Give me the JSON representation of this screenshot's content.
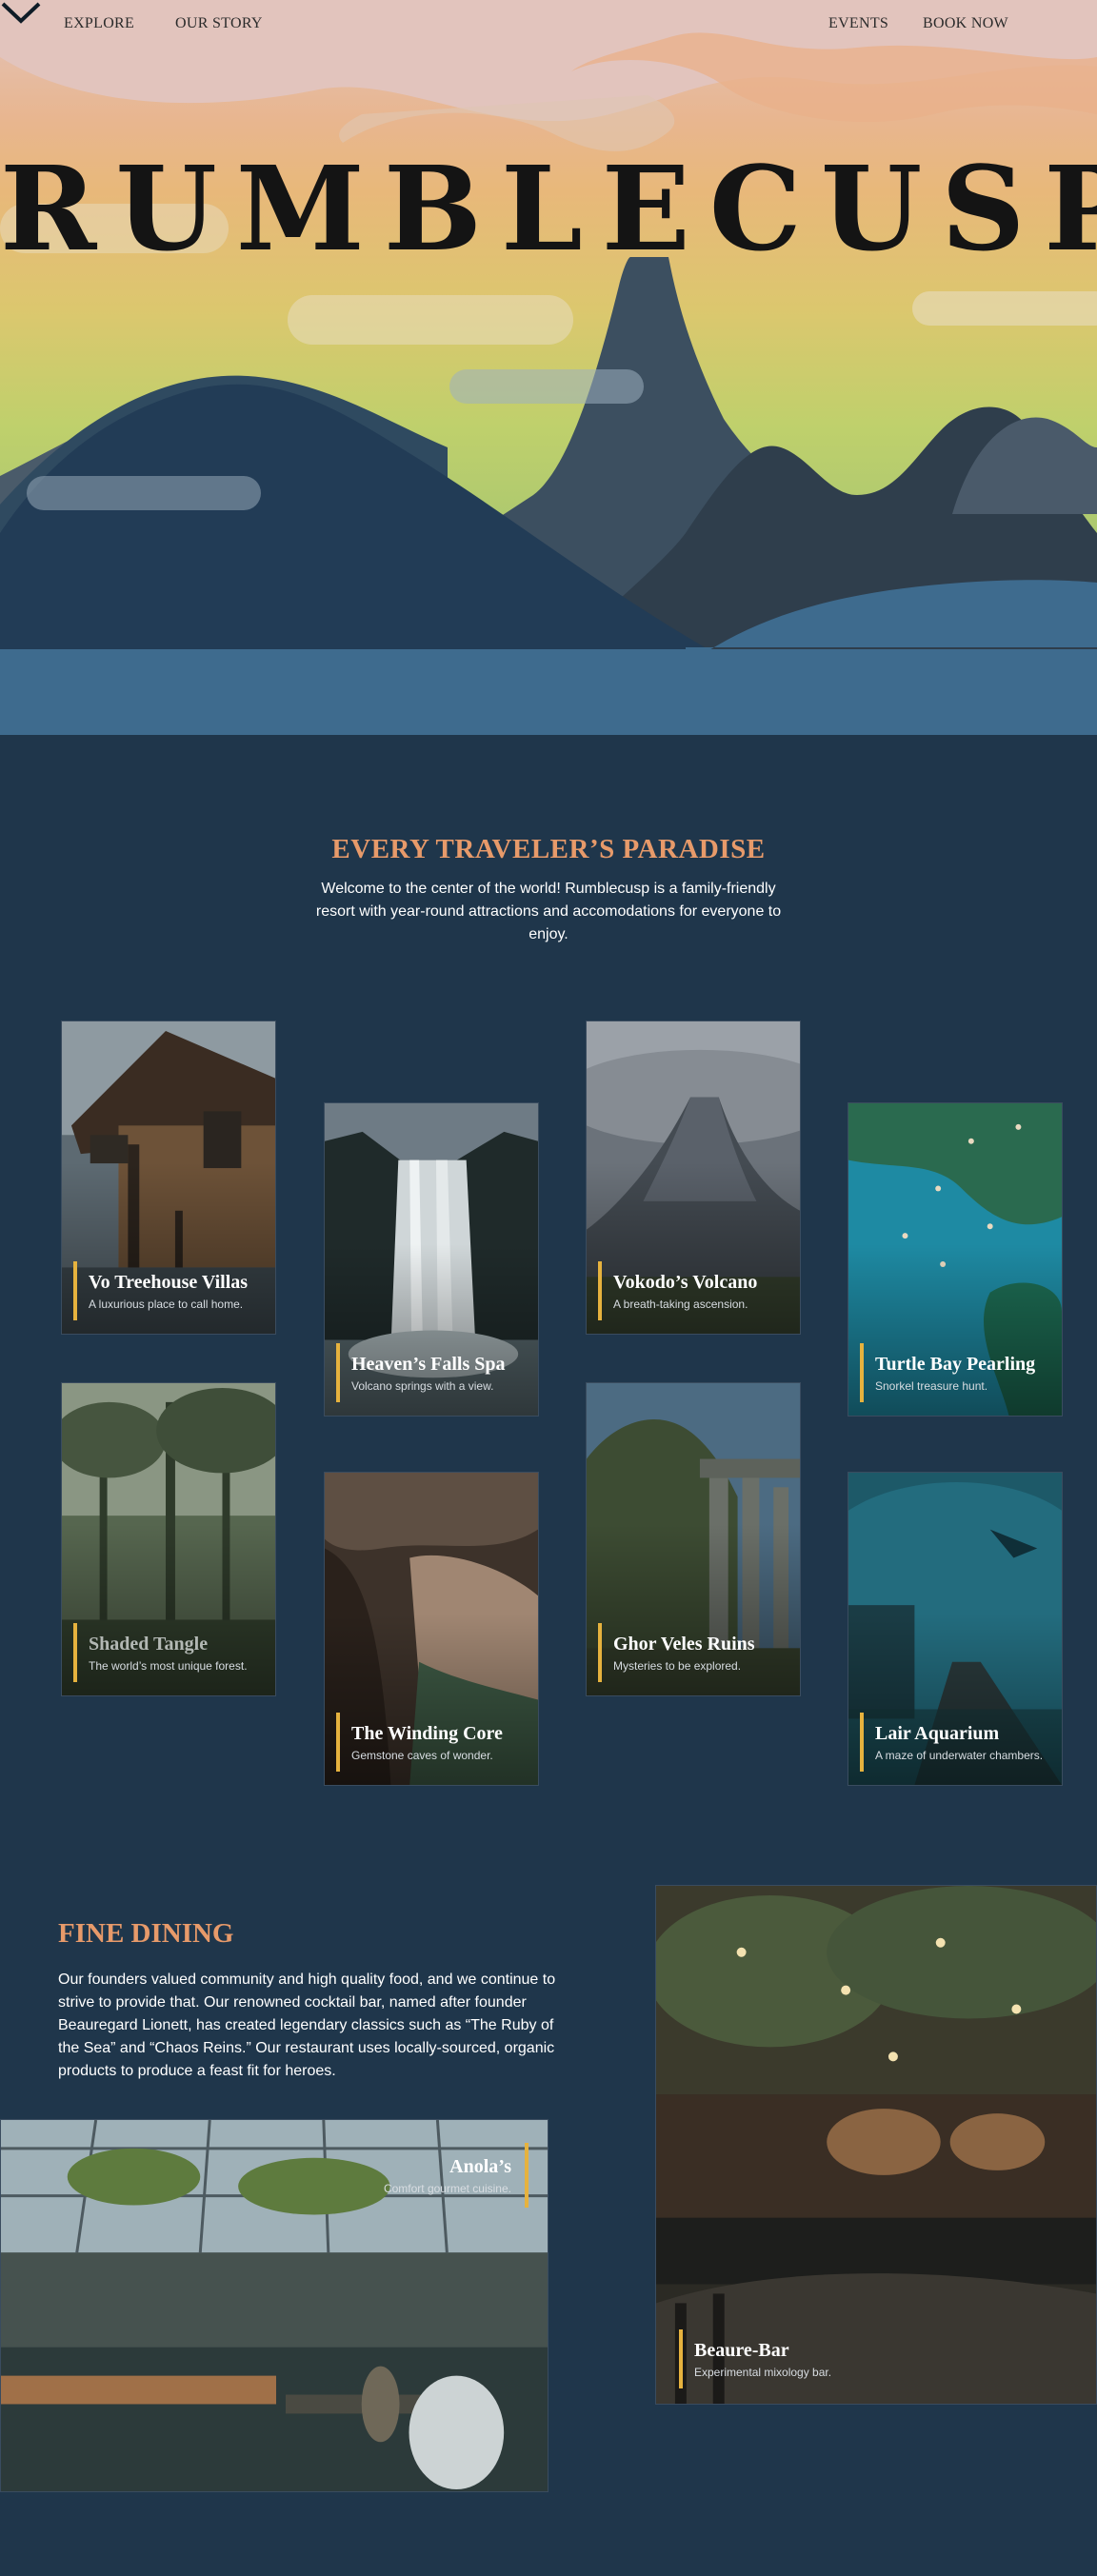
{
  "nav": {
    "explore": "EXPLORE",
    "our_story": "OUR STORY",
    "events": "EVENTS",
    "book_now": "BOOK NOW"
  },
  "hero": {
    "brand": "RUMBLECUSP",
    "scroll_icon": "chevron-down-icon"
  },
  "paradise": {
    "title": "EVERY TRAVELER’S PARADISE",
    "subtitle": "Welcome to the center of the world! Rumblecusp is a family-friendly resort with year-round attractions and accomodations for everyone to enjoy."
  },
  "attractions": [
    {
      "title": "Vo Treehouse Villas",
      "subtitle": "A luxurious place to call home."
    },
    {
      "title": "Heaven’s Falls Spa",
      "subtitle": "Volcano springs with a view."
    },
    {
      "title": "Vokodo’s Volcano",
      "subtitle": "A breath-taking ascension."
    },
    {
      "title": "Turtle Bay Pearling",
      "subtitle": "Snorkel treasure hunt."
    },
    {
      "title": "Shaded Tangle",
      "subtitle": "The world’s most unique forest."
    },
    {
      "title": "The Winding Core",
      "subtitle": "Gemstone caves of wonder."
    },
    {
      "title": "Ghor Veles Ruins",
      "subtitle": "Mysteries to be explored."
    },
    {
      "title": "Lair Aquarium",
      "subtitle": "A maze of underwater chambers."
    }
  ],
  "dining": {
    "title": "FINE DINING",
    "text": "Our founders valued community and high quality food, and we continue to strive to provide that. Our renowned cocktail bar, named after founder Beauregard Lionett, has created legendary classics such as “The Ruby of the Sea” and “Chaos Reins.” Our restaurant uses locally-sourced, organic products to produce a feast fit for heroes.",
    "restaurant": {
      "title": "Anola’s",
      "subtitle": "Comfort gourmet cuisine."
    },
    "bar": {
      "title": "Beaure-Bar",
      "subtitle": "Experimental mixology bar."
    }
  },
  "colors": {
    "background": "#1f364b",
    "accent": "#e79a6a",
    "caption_bar": "#e6b23e"
  }
}
